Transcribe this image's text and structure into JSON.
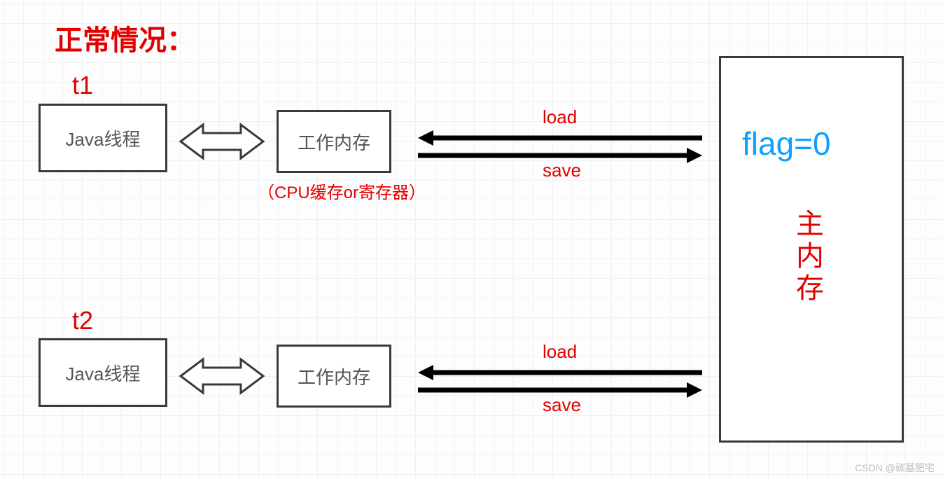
{
  "title": "正常情况：",
  "threads": {
    "t1": {
      "label": "t1",
      "java_thread": "Java线程",
      "work_mem": "工作内存"
    },
    "t2": {
      "label": "t2",
      "java_thread": "Java线程",
      "work_mem": "工作内存"
    }
  },
  "cpu_note": "（CPU缓存or寄存器）",
  "arrows": {
    "load": "load",
    "save": "save"
  },
  "main_memory": {
    "label": "主内存",
    "flag_text": "flag=0"
  },
  "watermark": "CSDN @碳基肥宅"
}
